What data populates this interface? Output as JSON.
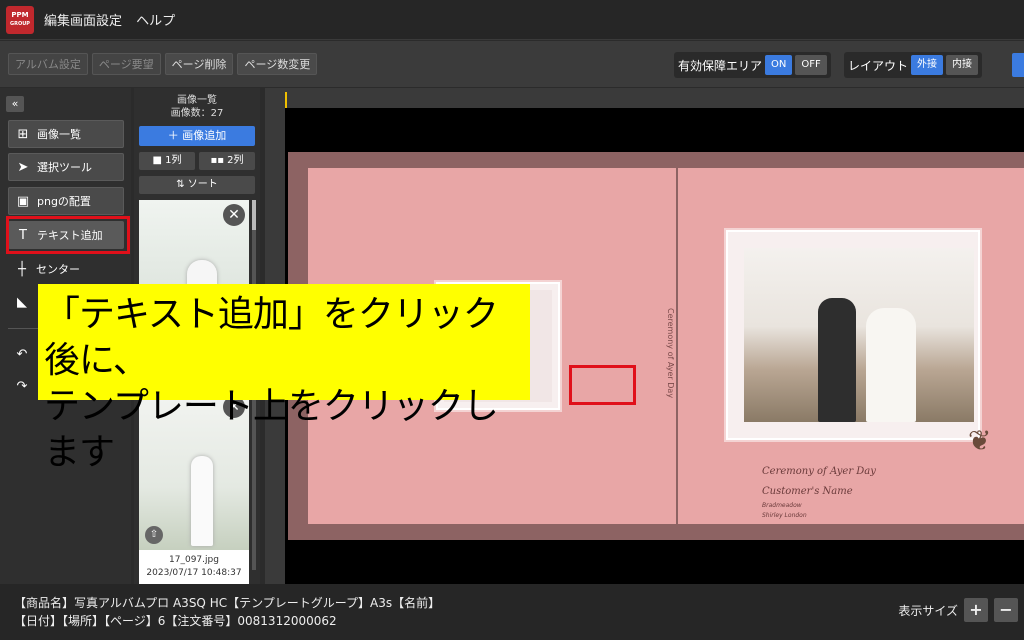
{
  "logo": {
    "line1": "PPM",
    "line2": "GROUP"
  },
  "menu": {
    "settings": "編集画面設定",
    "help": "ヘルプ"
  },
  "toolbar": {
    "album_settings": "アルバム設定",
    "page_request": "ページ要望",
    "page_delete": "ページ削除",
    "page_count": "ページ数変更",
    "safe_area_label": "有効保障エリア",
    "on": "ON",
    "off": "OFF",
    "layout_label": "レイアウト",
    "outer": "外接",
    "inner": "内接"
  },
  "sidebar": {
    "collapse": "«",
    "items": [
      {
        "icon": "⊞",
        "label": "画像一覧"
      },
      {
        "icon": "➤",
        "label": "選択ツール"
      },
      {
        "icon": "▣",
        "label": "pngの配置"
      },
      {
        "icon": "T",
        "label": "テキスト追加"
      },
      {
        "icon": "┼",
        "label": "センター"
      }
    ]
  },
  "images": {
    "title": "画像一覧",
    "count": "画像数：27",
    "add": "＋ 画像追加",
    "col1": "■ 1列",
    "col2": "▪▪ 2列",
    "sort": "⇅ ソート",
    "thumb_name": "17_097.jpg",
    "thumb_date": "2023/07/17 10:48:37"
  },
  "callout": {
    "line1": "「テキスト追加」をクリック後に、",
    "line2": "テンプレート上をクリックします"
  },
  "album_text": {
    "title": "Ceremony of Ayer Day",
    "name": "Customer's Name",
    "l3": "Bradmeadow",
    "l4": "Shirley London"
  },
  "status": {
    "line1": "【商品名】写真アルバムプロ A3SQ HC【テンプレートグループ】A3s【名前】",
    "line2": "【日付】【場所】【ページ】6【注文番号】0081312000062",
    "zoom_label": "表示サイズ",
    "plus": "+",
    "minus": "−"
  }
}
